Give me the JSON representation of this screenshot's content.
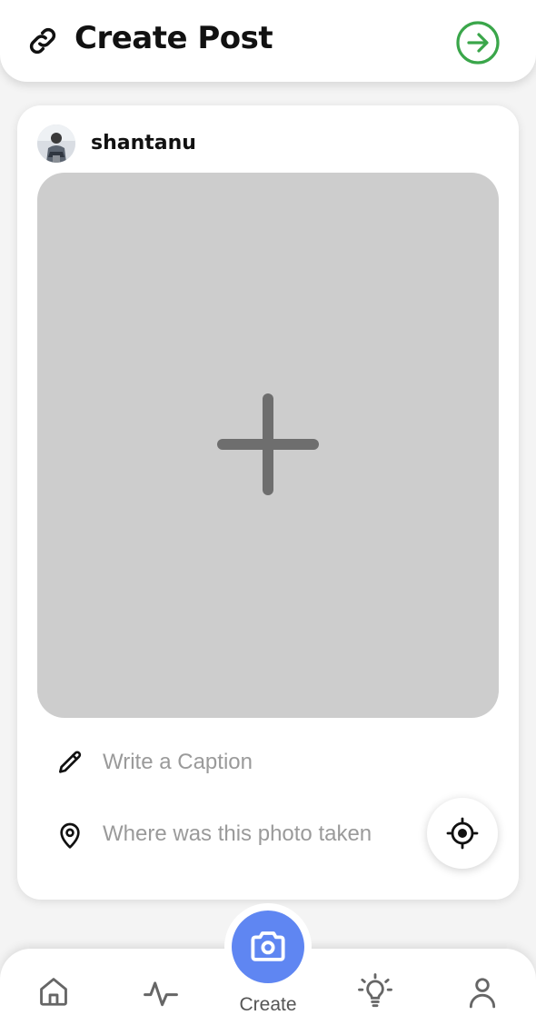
{
  "header": {
    "title": "Create Post",
    "link_icon": "link-icon",
    "next_icon": "arrow-right-circle-icon",
    "next_color": "#3aa64a"
  },
  "post": {
    "username": "shantanu",
    "avatar_icon": "user-avatar",
    "photo_placeholder_icon": "plus-icon",
    "photo_area_color": "#cdcdcd",
    "caption": {
      "icon": "pencil-icon",
      "placeholder": "Write a Caption",
      "value": ""
    },
    "location": {
      "icon": "location-pin-icon",
      "placeholder": "Where was this photo taken",
      "value": ""
    },
    "locate_icon": "crosshair-icon"
  },
  "bottom_nav": {
    "items": [
      {
        "icon": "home-icon"
      },
      {
        "icon": "activity-icon"
      },
      {
        "icon": "camera-icon",
        "label": "Create",
        "active": true
      },
      {
        "icon": "lightbulb-icon"
      },
      {
        "icon": "profile-icon"
      }
    ],
    "create_label": "Create",
    "accent_color": "#5f86f2"
  }
}
